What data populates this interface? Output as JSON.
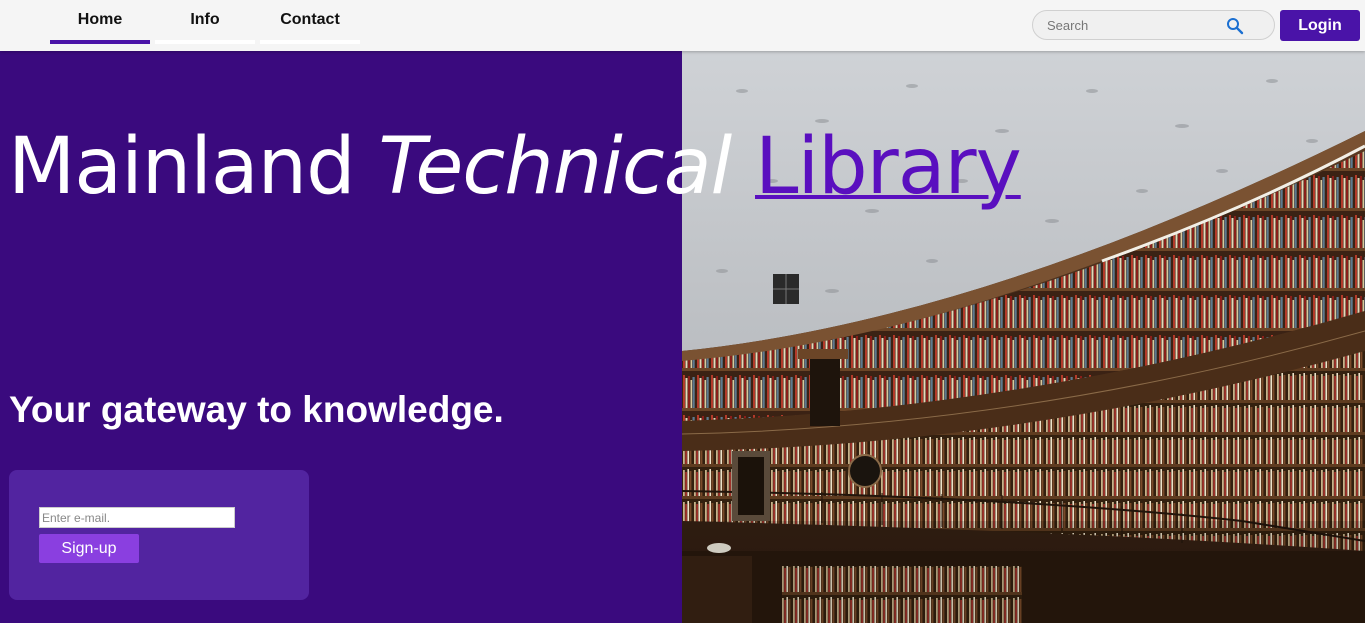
{
  "nav": {
    "tabs": [
      {
        "label": "Home",
        "active": true
      },
      {
        "label": "Info",
        "active": false
      },
      {
        "label": "Contact",
        "active": false
      }
    ],
    "search_placeholder": "Search",
    "search_icon": "search-icon",
    "login_label": "Login"
  },
  "hero": {
    "title_part1": "Mainland",
    "title_part2": "Technical",
    "title_part3": "Library",
    "tagline": "Your gateway to knowledge.",
    "email_placeholder": "Enter e-mail.",
    "signup_label": "Sign-up"
  },
  "colors": {
    "accent": "#4a13a8",
    "hero_bg": "#3a0a7e",
    "card_bg": "#5224a0",
    "signup_button": "#8a3fe0",
    "link": "#5a0fbf"
  }
}
